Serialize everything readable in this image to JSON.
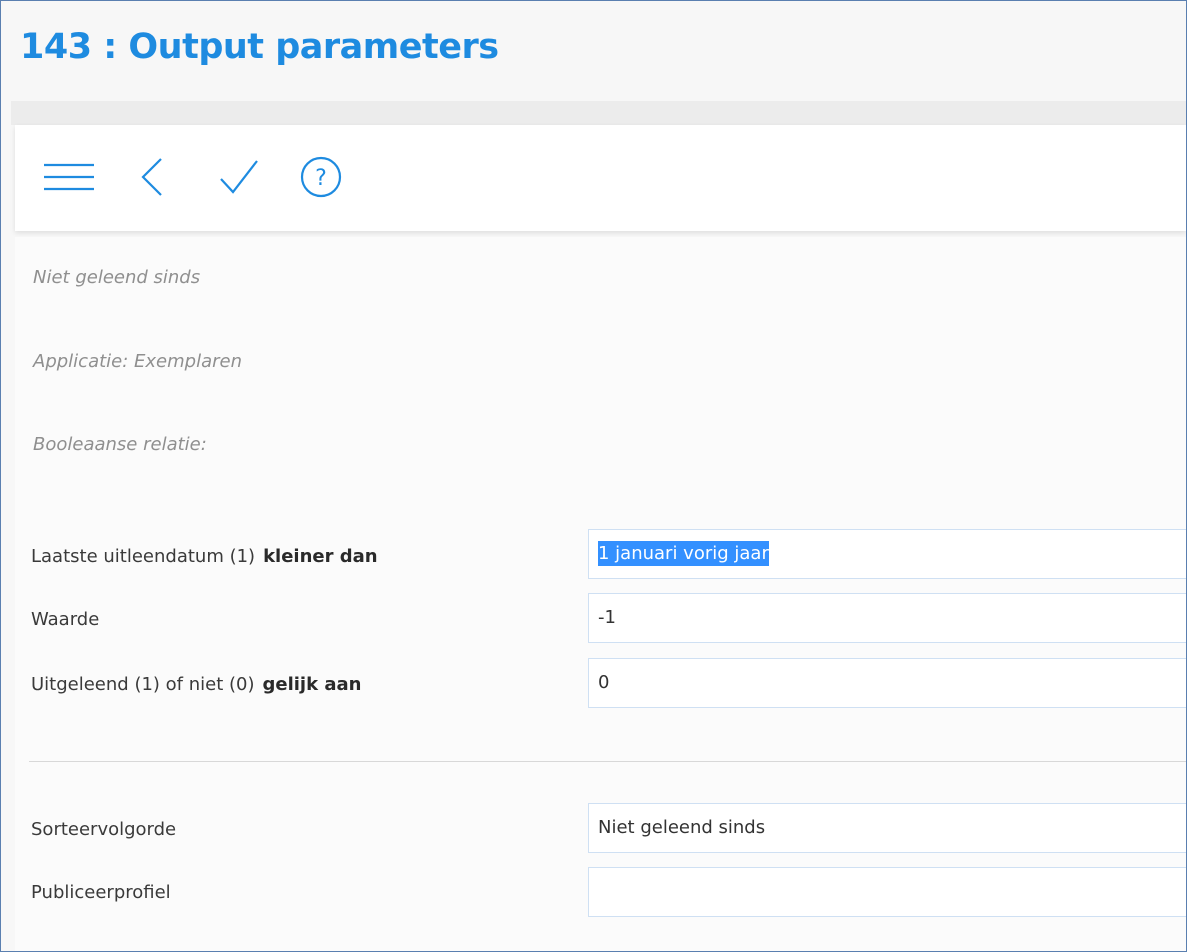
{
  "window": {
    "title": "143 : Output parameters"
  },
  "toolbar": {
    "menu_icon": "hamburger-menu-icon",
    "back_icon": "chevron-left-icon",
    "confirm_icon": "checkmark-icon",
    "help_icon": "question-circle-icon",
    "icon_color": "#1e8be0"
  },
  "info": {
    "query_name": "Niet geleend sinds",
    "application": "Applicatie: Exemplaren",
    "boolean_relation": "Booleaanse relatie:"
  },
  "conditions": [
    {
      "field": "Laatste uitleendatum (1)",
      "operator": "kleiner dan",
      "value": "1 januari vorig jaar"
    },
    {
      "field": "Waarde",
      "operator": "",
      "value": "-1"
    },
    {
      "field": "Uitgeleend (1) of niet (0)",
      "operator": "gelijk aan",
      "value": "0"
    }
  ],
  "output": {
    "sort_label": "Sorteervolgorde",
    "sort_value": "Niet geleend sinds",
    "publish_label": "Publiceerprofiel",
    "publish_value": ""
  },
  "colors": {
    "accent": "#1e8be0",
    "selection": "#3390ff",
    "field_border": "#cfe0f3"
  }
}
